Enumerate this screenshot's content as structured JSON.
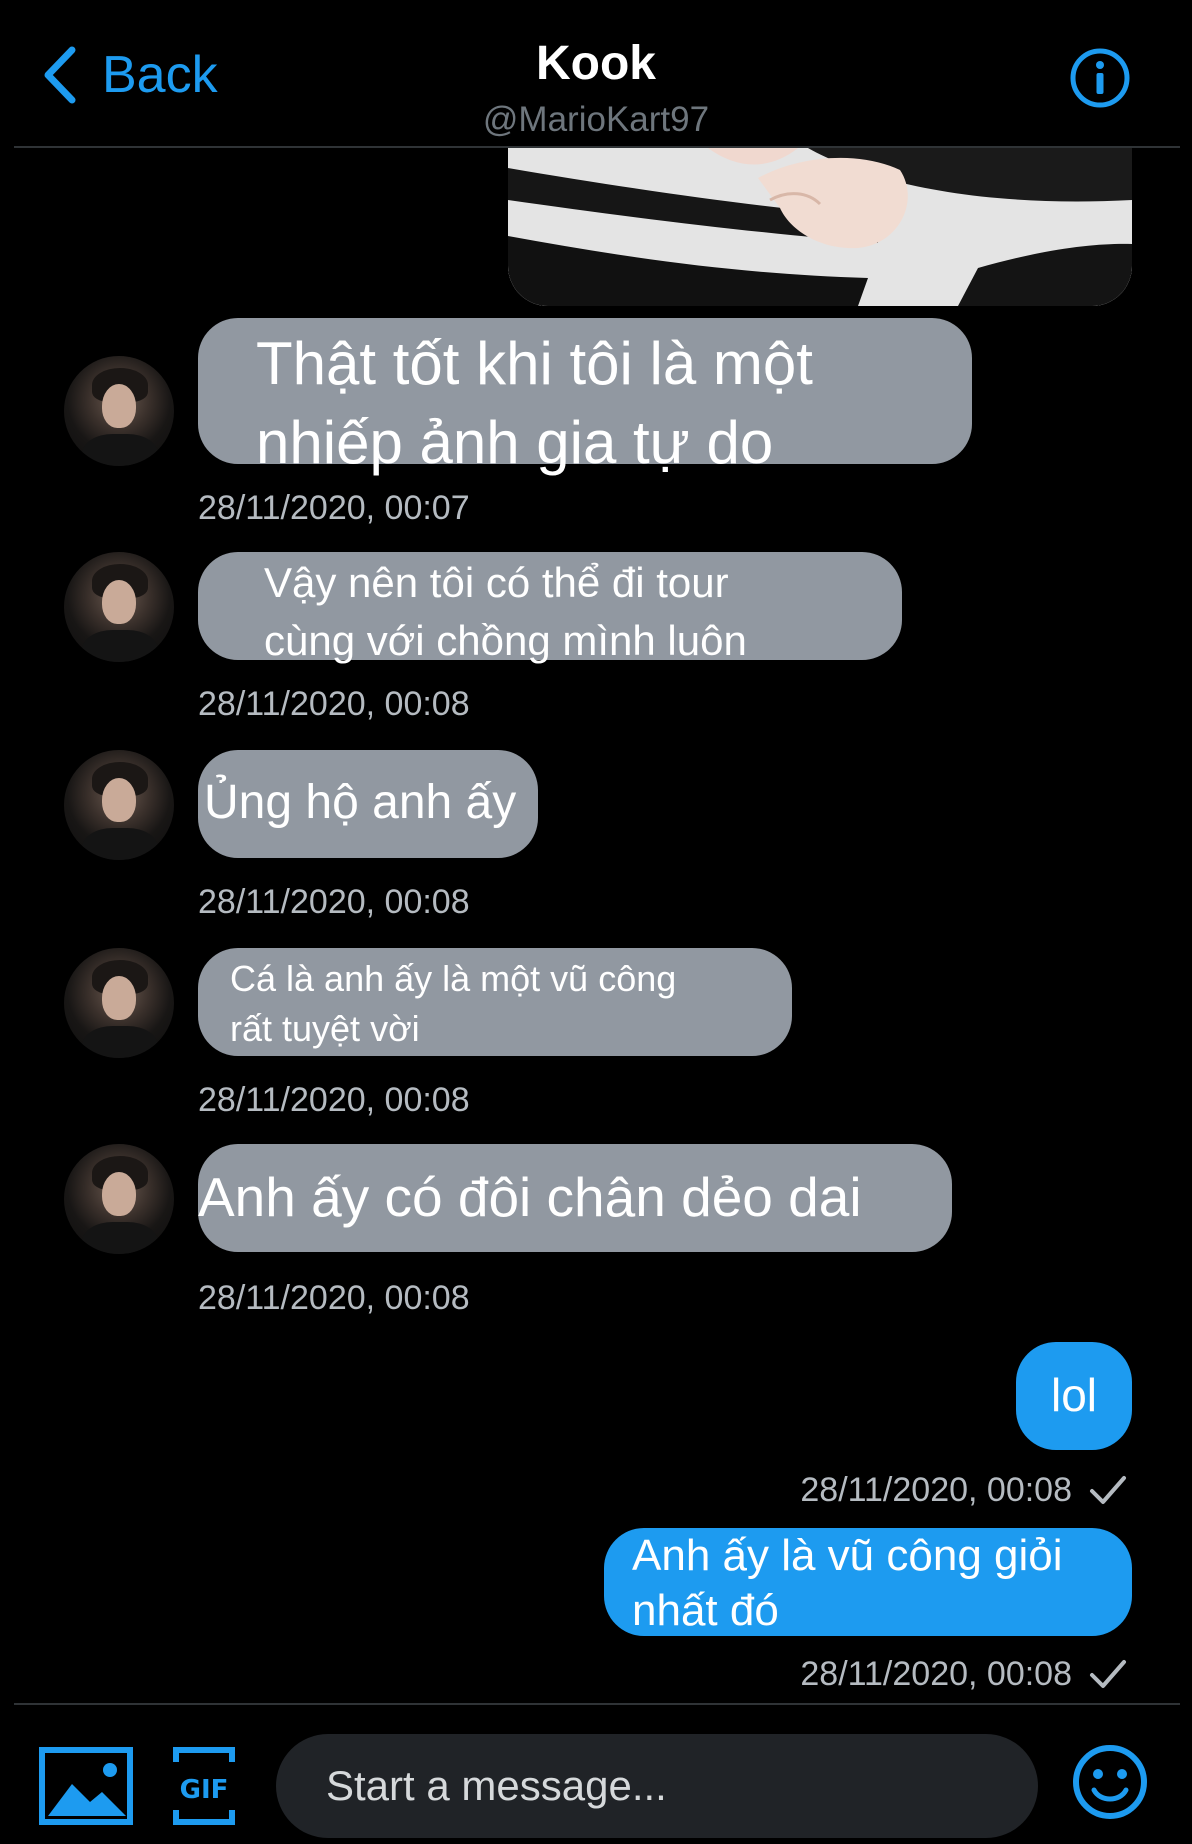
{
  "header": {
    "back_label": "Back",
    "title": "Kook",
    "handle": "@MarioKart97"
  },
  "messages_in": [
    {
      "text": "Thật tốt khi tôi là một\nnhiếp ảnh gia tự do",
      "time": "28/11/2020, 00:07"
    },
    {
      "text": "Vậy nên tôi có thể đi tour\ncùng với chồng mình luôn",
      "time": "28/11/2020, 00:08"
    },
    {
      "text": "Ủng hộ anh ấy",
      "time": "28/11/2020, 00:08"
    },
    {
      "text": "Cá là anh ấy là một vũ công\nrất tuyệt vời",
      "time": "28/11/2020, 00:08"
    },
    {
      "text": "Anh ấy có đôi chân dẻo dai",
      "time": "28/11/2020, 00:08"
    }
  ],
  "messages_out": [
    {
      "text": "lol",
      "time": "28/11/2020, 00:08"
    },
    {
      "text": "Anh ấy là vũ công giỏi\nnhất đó",
      "time": "28/11/2020, 00:08"
    }
  ],
  "composer": {
    "placeholder": "Start a message..."
  },
  "icons": {
    "back": "chevron-left-icon",
    "info": "info-icon",
    "media": "image-icon",
    "gif": "gif-icon",
    "emoji": "emoji-icon",
    "read": "checkmark-icon"
  },
  "colors": {
    "accent": "#1d9bf0",
    "bubble_in": "#9198a1",
    "background": "#000000"
  }
}
